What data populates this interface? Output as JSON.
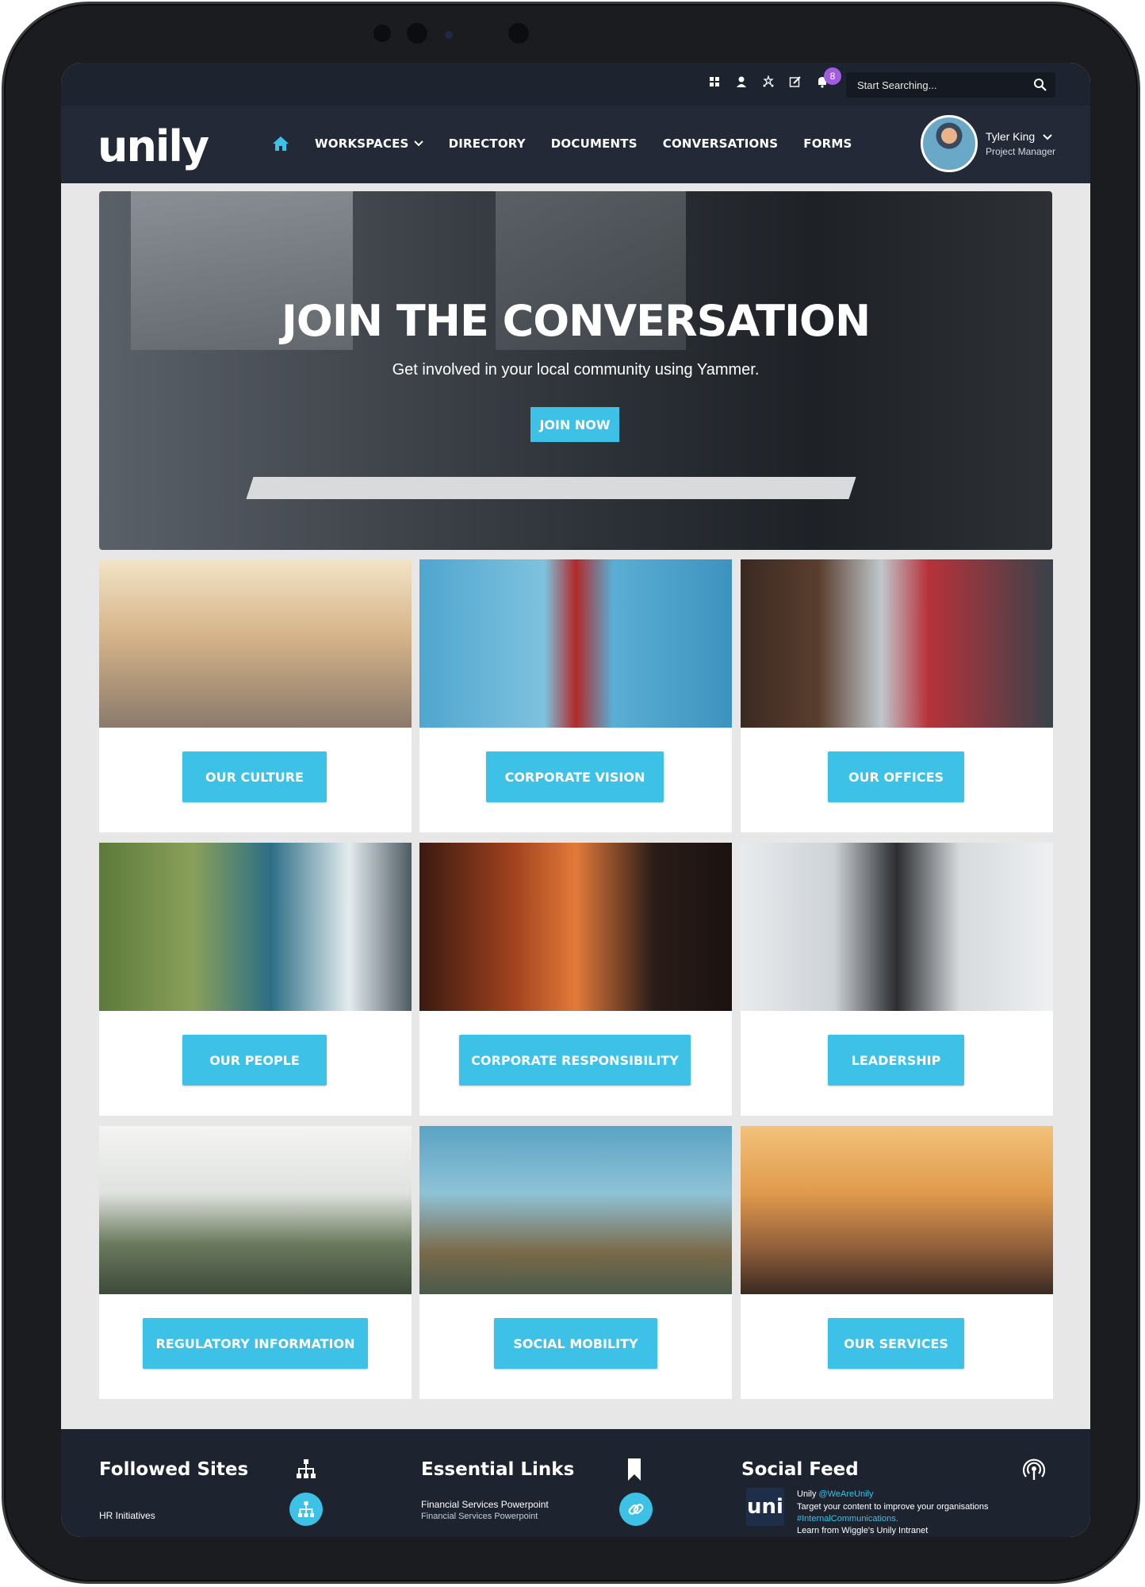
{
  "topbar": {
    "notifications_count": "8",
    "search_placeholder": "Start Searching...",
    "icons": [
      "windows-icon",
      "person-icon",
      "stars-icon",
      "edit-icon",
      "bell-icon",
      "search-icon"
    ]
  },
  "nav": {
    "logo": "unily",
    "items": [
      "WORKSPACES",
      "DIRECTORY",
      "DOCUMENTS",
      "CONVERSATIONS",
      "FORMS"
    ]
  },
  "user": {
    "name": "Tyler King",
    "role": "Project Manager"
  },
  "hero": {
    "title": "JOIN THE CONVERSATION",
    "subtitle": "Get involved in your local community using Yammer.",
    "button": "JOIN NOW"
  },
  "tiles": [
    {
      "label": "OUR CULTURE"
    },
    {
      "label": "CORPORATE VISION"
    },
    {
      "label": "OUR OFFICES"
    },
    {
      "label": "OUR PEOPLE"
    },
    {
      "label": "CORPORATE RESPONSIBILITY"
    },
    {
      "label": "LEADERSHIP"
    },
    {
      "label": "REGULATORY INFORMATION"
    },
    {
      "label": "SOCIAL MOBILITY"
    },
    {
      "label": "OUR SERVICES"
    }
  ],
  "footer": {
    "followed": {
      "title": "Followed Sites",
      "item": "HR Initiatives"
    },
    "links": {
      "title": "Essential Links",
      "item": "Financial Services Powerpoint",
      "sub": "Financial Services Powerpoint"
    },
    "social": {
      "title": "Social Feed",
      "author": "Unily",
      "handle": "@WeAreUnily",
      "line1": "Target your content to improve your organisations",
      "hashtag": "#InternalCommunications.",
      "line3": "Learn from Wiggle's Unily Intranet",
      "logo_text": "uni"
    }
  },
  "colors": {
    "accent": "#3ec1e6",
    "nav_bg": "#232937",
    "footer_bg": "#1e2330",
    "badge": "#a05de0"
  }
}
